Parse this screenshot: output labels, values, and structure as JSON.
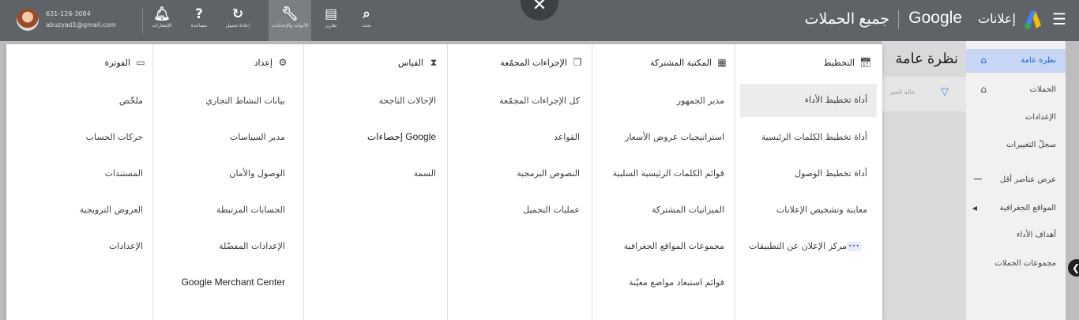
{
  "header": {
    "account": {
      "phone": "631-126-3084",
      "email": "abuzyad1@gmail.com"
    },
    "toolbar": [
      {
        "name": "notifications",
        "icon": "bell-icon",
        "label": "الإشعارات"
      },
      {
        "name": "help",
        "icon": "help-icon",
        "label": "مساعدة"
      },
      {
        "name": "refresh",
        "icon": "refresh-icon",
        "label": "إعادة تحميل"
      },
      {
        "name": "tools",
        "icon": "wrench-icon",
        "label": "الأدوات والإعدادات"
      },
      {
        "name": "reports",
        "icon": "reports-icon",
        "label": "تقارير"
      },
      {
        "name": "search",
        "icon": "search-icon",
        "label": "بحث"
      }
    ],
    "page_title": "جميع الحملات",
    "brand_google": "Google",
    "brand_ads": "إعلانات"
  },
  "sidebar": {
    "items": [
      {
        "label": "نظرة عامة"
      },
      {
        "label": "الحملات"
      },
      {
        "label": "الإعدادات"
      },
      {
        "label": "سجلّ التغييرات"
      },
      {
        "label": "عرض عناصر أقل"
      },
      {
        "label": "المواقع الجغرافية"
      },
      {
        "label": "أهداف الأداء"
      },
      {
        "label": "مجموعات الحملات"
      }
    ]
  },
  "content": {
    "heading": "نظرة عامة",
    "filter_placeholder": "حالة الحم"
  },
  "menu": {
    "columns": [
      {
        "heading": "التخطيط",
        "icon": "calendar-icon",
        "items": [
          "أداة تخطيط الأداء",
          "أداة تخطيط الكلمات الرئيسية",
          "أداة تخطيط الوصول",
          "معاينة وتشخيص الإعلانات",
          "مركز الإعلان عن التطبيقات"
        ]
      },
      {
        "heading": "المكتبة المشتركة",
        "icon": "library-icon",
        "items": [
          "مدير الجمهور",
          "استراتيجيات عروض الأسعار",
          "قوائم الكلمات الرئيسية السلبية",
          "الميزانيات المشتركة",
          "مجموعات المواقع الجغرافية",
          "قوائم استبعاد مواضع معيّنة"
        ]
      },
      {
        "heading": "الإجراءات المجمّعة",
        "icon": "copy-icon",
        "items": [
          "كل الإجراءات المجمّعة",
          "القواعد",
          "النصوص البرمجية",
          "عمليات التحميل"
        ]
      },
      {
        "heading": "القياس",
        "icon": "hourglass-icon",
        "items": [
          "الإحالات الناجحة",
          "إحصاءات Google",
          "السمة"
        ]
      },
      {
        "heading": "إعداد",
        "icon": "settings-icon",
        "items": [
          "بيانات النشاط التجاري",
          "مدير السياسات",
          "الوصول والأمان",
          "الحسابات المرتبطة",
          "الإعدادات المفضّلة",
          "Google Merchant Center"
        ]
      },
      {
        "heading": "الفوترة",
        "icon": "card-icon",
        "items": [
          "ملخّص",
          "حركات الحساب",
          "المستندات",
          "العروض الترويجية",
          "الإعدادات"
        ]
      }
    ]
  }
}
